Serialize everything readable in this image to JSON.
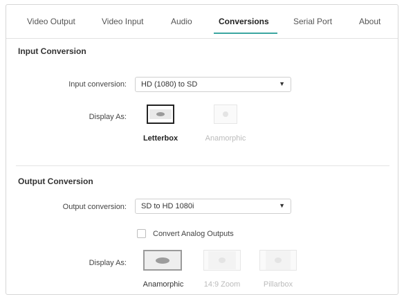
{
  "tabs": [
    {
      "label": "Video Output"
    },
    {
      "label": "Video Input"
    },
    {
      "label": "Audio"
    },
    {
      "label": "Conversions"
    },
    {
      "label": "Serial Port"
    },
    {
      "label": "About"
    }
  ],
  "active_tab": "Conversions",
  "input_conversion": {
    "title": "Input Conversion",
    "select_label": "Input conversion:",
    "select_value": "HD (1080) to SD",
    "display_label": "Display As:",
    "options": [
      {
        "label": "Letterbox",
        "selected": true
      },
      {
        "label": "Anamorphic",
        "selected": false
      }
    ]
  },
  "output_conversion": {
    "title": "Output Conversion",
    "select_label": "Output conversion:",
    "select_value": "SD to HD 1080i",
    "checkbox_label": "Convert Analog Outputs",
    "checkbox_checked": false,
    "display_label": "Display As:",
    "options": [
      {
        "label": "Anamorphic",
        "selected": true
      },
      {
        "label": "14:9 Zoom",
        "selected": false
      },
      {
        "label": "Pillarbox",
        "selected": false
      }
    ]
  },
  "colors": {
    "accent": "#3aa6a0"
  },
  "icons": {
    "dropdown": "caret-down-icon"
  }
}
